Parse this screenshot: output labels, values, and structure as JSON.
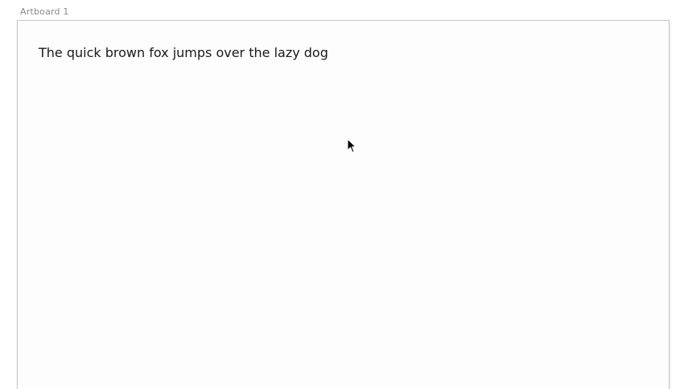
{
  "artboard": {
    "label": "Artboard 1",
    "text_layer": "The quick brown fox jumps over the lazy dog"
  },
  "cursor": {
    "icon": "arrow-pointer-icon"
  },
  "colors": {
    "background": "#ffffff",
    "artboard_fill": "#fdfdfd",
    "artboard_border": "#c9c9c9",
    "label_text": "#8a8a8a",
    "body_text": "#1a1a1a"
  }
}
